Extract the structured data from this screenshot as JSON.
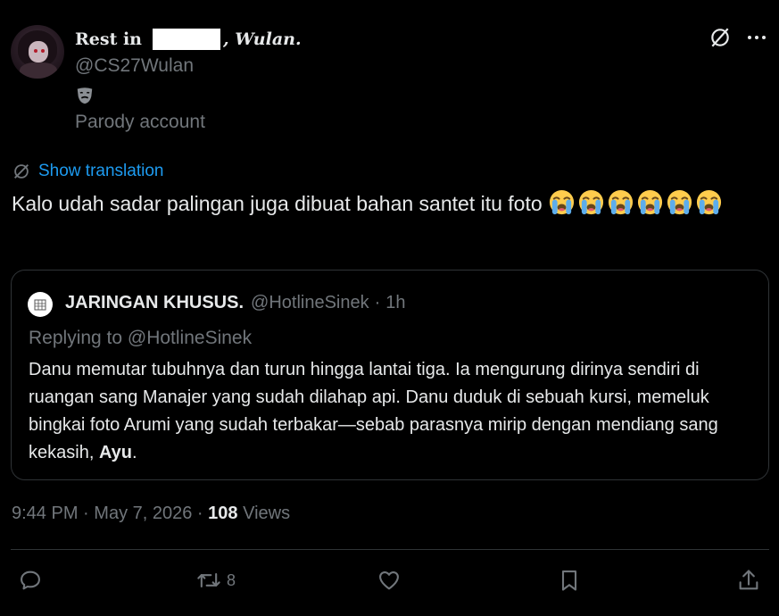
{
  "author": {
    "name_start": "Rest in",
    "name_end": ", Wulan.",
    "handle": "@CS27Wulan",
    "parody_icon": "theater-mask-icon",
    "parody_label": "Parody account"
  },
  "header_icons": {
    "translate": "translate-icon",
    "more": "more-icon"
  },
  "show_translation": "Show translation",
  "tweet": {
    "text": "Kalo udah sadar palingan juga dibuat bahan santet itu foto",
    "emoji_name": "loudly-crying-face",
    "emoji_count": 6
  },
  "quote": {
    "name": "JARINGAN KHUSUS.",
    "handle": "@HotlineSinek",
    "separator": "·",
    "time": "1h",
    "replying_to": "Replying to @HotlineSinek",
    "body": "Danu memutar tubuhnya dan turun hingga lantai tiga. Ia mengurung dirinya sendiri di ruangan sang Manajer yang sudah dilahap api. Danu duduk di sebuah kursi, memeluk bingkai foto Arumi yang sudah terbakar—sebab parasnya mirip dengan mendiang sang kekasih,",
    "body_bold": "Ayu",
    "body_end": "."
  },
  "meta": {
    "time": "9:44 PM",
    "date": "May 7, 2026",
    "views_count": "108",
    "views_label": "Views",
    "separator": "·"
  },
  "actions": {
    "reply_icon": "reply-icon",
    "retweet_icon": "retweet-icon",
    "retweet_count": "8",
    "like_icon": "heart-icon",
    "bookmark_icon": "bookmark-icon",
    "share_icon": "share-icon"
  },
  "colors": {
    "background": "#000000",
    "text": "#e7e9ea",
    "muted": "#71767b",
    "accent": "#1d9bf0",
    "border": "#2f3336"
  }
}
